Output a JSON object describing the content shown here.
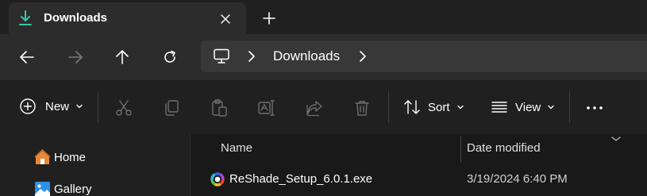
{
  "tab": {
    "title": "Downloads",
    "icon": "download-arrow-icon",
    "accent": "#3fc3a8"
  },
  "navigation": {
    "back_icon": "arrow-left-icon",
    "forward_icon": "arrow-right-icon",
    "up_icon": "arrow-up-icon",
    "refresh_icon": "refresh-icon"
  },
  "address": {
    "root_icon": "this-pc-icon",
    "crumb": "Downloads"
  },
  "commands": {
    "new_label": "New",
    "sort_label": "Sort",
    "view_label": "View",
    "cut_icon": "scissors-icon",
    "copy_icon": "copy-icon",
    "paste_icon": "clipboard-icon",
    "rename_icon": "rename-icon",
    "share_icon": "share-icon",
    "delete_icon": "trash-icon",
    "more_icon": "ellipsis-icon"
  },
  "sidebar": {
    "items": [
      {
        "label": "Home",
        "icon": "home-icon"
      },
      {
        "label": "Gallery",
        "icon": "gallery-icon"
      }
    ]
  },
  "filelist": {
    "columns": [
      "Name",
      "Date modified"
    ],
    "rows": [
      {
        "name": "ReShade_Setup_6.0.1.exe",
        "date": "3/19/2024 6:40 PM",
        "icon": "reshade-app-icon"
      }
    ]
  }
}
